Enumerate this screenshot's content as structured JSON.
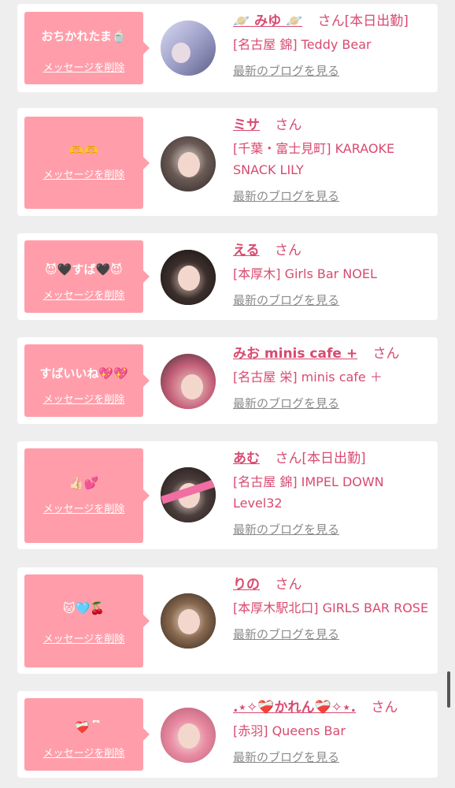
{
  "delete_label": "メッセージを削除",
  "blog_label": "最新のブログを見る",
  "san_label": "さん",
  "colors": {
    "accent": "#d84a70",
    "bubble": "#ff9eaa",
    "background": "#eeeeee"
  },
  "entries": [
    {
      "message": "おちかれたま🍵",
      "name": "🪐 みゆ 🪐",
      "status": "[本日出勤]",
      "shop": "[名古屋 錦] Teddy Bear"
    },
    {
      "message": "🫶🫶",
      "name": "ミサ",
      "status": "",
      "shop": "[千葉・富士見町] KARAOKE SNACK LILY"
    },
    {
      "message": "😈🖤すば🖤😈",
      "name": "える",
      "status": "",
      "shop": "[本厚木] Girls Bar NOEL"
    },
    {
      "message": "すばいいね💖💖",
      "name": "みお minis cafe +",
      "status": "",
      "shop": "[名古屋 栄] minis cafe ＋"
    },
    {
      "message": "👍🏻💕",
      "name": "あむ",
      "status": "[本日出勤]",
      "shop": "[名古屋 錦] IMPEL DOWN Level32"
    },
    {
      "message": "🐱🩵🍒",
      "name": "りの",
      "status": "",
      "shop": "[本厚木駅北口] GIRLS BAR ROSE"
    },
    {
      "message": "❤️‍🩹 ྀི",
      "name": ".⋆✧❤️‍🩹かれん❤️‍🩹✧⋆.",
      "status": "",
      "shop": "[赤羽] Queens Bar"
    }
  ]
}
